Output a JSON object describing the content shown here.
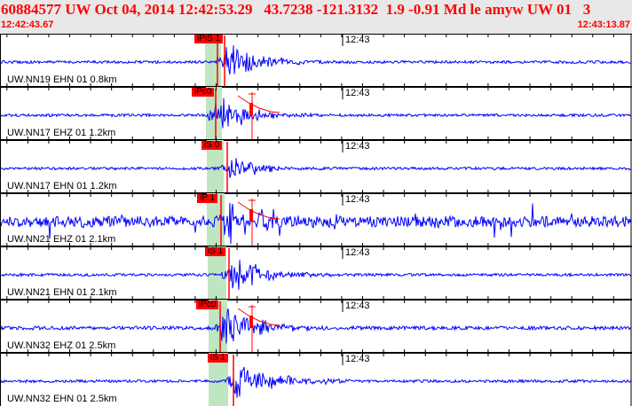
{
  "header": {
    "title": "60884577 UW Oct 04, 2014 12:42:53.29   43.7238 -121.3132  1.9 -0.91 Md le amyw UW 01   3",
    "start_time": "12:42:43.67",
    "end_time": "12:43:13.87",
    "minute_label": "12:43"
  },
  "colors": {
    "trace": "#0000ff",
    "pick": "#ff0000",
    "window": "#bfe6c0",
    "header_bg": "#e8e8e8"
  },
  "traces": [
    {
      "label": "UW.NN19 EHN 01 0.8km",
      "pick": "iPiS 1"
    },
    {
      "label": "UW.NN17 EHZ 01 1.2km",
      "pick": "iPc0"
    },
    {
      "label": "UW.NN17 EHN 01 1.2km",
      "pick": "iS 0"
    },
    {
      "label": "UW.NN21 EHZ 01 2.1km",
      "pick": "iP 1"
    },
    {
      "label": "UW.NN21 EHN 01 2.1km",
      "pick": "iS 1"
    },
    {
      "label": "UW.NN32 EHZ 01 2.5km",
      "pick": "iPc0"
    },
    {
      "label": "UW.NN32 EHN 01 2.5km",
      "pick": "iS 1"
    }
  ]
}
